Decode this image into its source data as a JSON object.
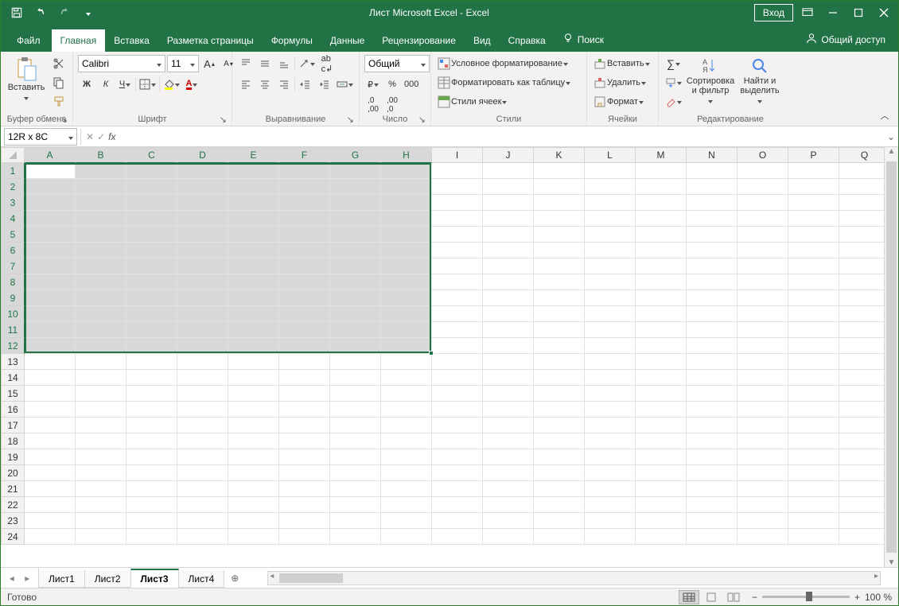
{
  "title": "Лист Microsoft Excel  -  Excel",
  "signin": "Вход",
  "share": "Общий доступ",
  "tellme": "Поиск",
  "tabs": {
    "file": "Файл",
    "home": "Главная",
    "insert": "Вставка",
    "layout": "Разметка страницы",
    "formulas": "Формулы",
    "data": "Данные",
    "review": "Рецензирование",
    "view": "Вид",
    "help": "Справка"
  },
  "ribbon": {
    "clipboard": {
      "caption": "Буфер обмена",
      "paste": "Вставить"
    },
    "font": {
      "caption": "Шрифт",
      "name": "Calibri",
      "size": "11",
      "bold": "Ж",
      "italic": "К",
      "underline": "Ч"
    },
    "alignment": {
      "caption": "Выравнивание"
    },
    "number": {
      "caption": "Число",
      "format": "Общий"
    },
    "styles": {
      "caption": "Стили",
      "cond": "Условное форматирование",
      "table": "Форматировать как таблицу",
      "cellstyles": "Стили ячеек"
    },
    "cells": {
      "caption": "Ячейки",
      "insert": "Вставить",
      "delete": "Удалить",
      "format": "Формат"
    },
    "editing": {
      "caption": "Редактирование",
      "sortfilter": "Сортировка\nи фильтр",
      "findselect": "Найти и\nвыделить"
    }
  },
  "namebox": "12R x 8C",
  "columns": [
    "A",
    "B",
    "C",
    "D",
    "E",
    "F",
    "G",
    "H",
    "I",
    "J",
    "K",
    "L",
    "M",
    "N",
    "O",
    "P",
    "Q"
  ],
  "selectedCols": 8,
  "rows": 24,
  "selectedRows": 12,
  "sheets": {
    "items": [
      "Лист1",
      "Лист2",
      "Лист3",
      "Лист4"
    ],
    "activeIndex": 2
  },
  "status": "Готово",
  "zoom": "100 %"
}
